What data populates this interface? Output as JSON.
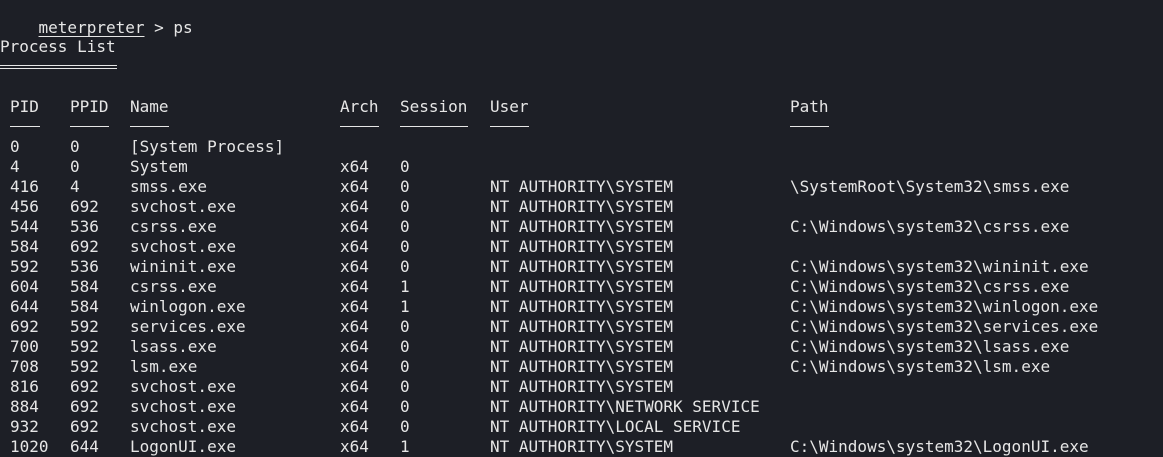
{
  "prompt": {
    "label": "meterpreter",
    "separator": " > ",
    "command": "ps"
  },
  "section_title": "Process List",
  "columns": [
    "PID",
    "PPID",
    "Name",
    "Arch",
    "Session",
    "User",
    "Path"
  ],
  "rows": [
    [
      "0",
      "0",
      "[System Process]",
      "",
      "",
      "",
      ""
    ],
    [
      "4",
      "0",
      "System",
      "x64",
      "0",
      "",
      ""
    ],
    [
      "416",
      "4",
      "smss.exe",
      "x64",
      "0",
      "NT AUTHORITY\\SYSTEM",
      "\\SystemRoot\\System32\\smss.exe"
    ],
    [
      "456",
      "692",
      "svchost.exe",
      "x64",
      "0",
      "NT AUTHORITY\\SYSTEM",
      ""
    ],
    [
      "544",
      "536",
      "csrss.exe",
      "x64",
      "0",
      "NT AUTHORITY\\SYSTEM",
      "C:\\Windows\\system32\\csrss.exe"
    ],
    [
      "584",
      "692",
      "svchost.exe",
      "x64",
      "0",
      "NT AUTHORITY\\SYSTEM",
      ""
    ],
    [
      "592",
      "536",
      "wininit.exe",
      "x64",
      "0",
      "NT AUTHORITY\\SYSTEM",
      "C:\\Windows\\system32\\wininit.exe"
    ],
    [
      "604",
      "584",
      "csrss.exe",
      "x64",
      "1",
      "NT AUTHORITY\\SYSTEM",
      "C:\\Windows\\system32\\csrss.exe"
    ],
    [
      "644",
      "584",
      "winlogon.exe",
      "x64",
      "1",
      "NT AUTHORITY\\SYSTEM",
      "C:\\Windows\\system32\\winlogon.exe"
    ],
    [
      "692",
      "592",
      "services.exe",
      "x64",
      "0",
      "NT AUTHORITY\\SYSTEM",
      "C:\\Windows\\system32\\services.exe"
    ],
    [
      "700",
      "592",
      "lsass.exe",
      "x64",
      "0",
      "NT AUTHORITY\\SYSTEM",
      "C:\\Windows\\system32\\lsass.exe"
    ],
    [
      "708",
      "592",
      "lsm.exe",
      "x64",
      "0",
      "NT AUTHORITY\\SYSTEM",
      "C:\\Windows\\system32\\lsm.exe"
    ],
    [
      "816",
      "692",
      "svchost.exe",
      "x64",
      "0",
      "NT AUTHORITY\\SYSTEM",
      ""
    ],
    [
      "884",
      "692",
      "svchost.exe",
      "x64",
      "0",
      "NT AUTHORITY\\NETWORK SERVICE",
      ""
    ],
    [
      "932",
      "692",
      "svchost.exe",
      "x64",
      "0",
      "NT AUTHORITY\\LOCAL SERVICE",
      ""
    ],
    [
      "1020",
      "644",
      "LogonUI.exe",
      "x64",
      "1",
      "NT AUTHORITY\\SYSTEM",
      "C:\\Windows\\system32\\LogonUI.exe"
    ]
  ],
  "colors": {
    "background": "#1d1f26",
    "foreground": "#e6e6e6"
  }
}
